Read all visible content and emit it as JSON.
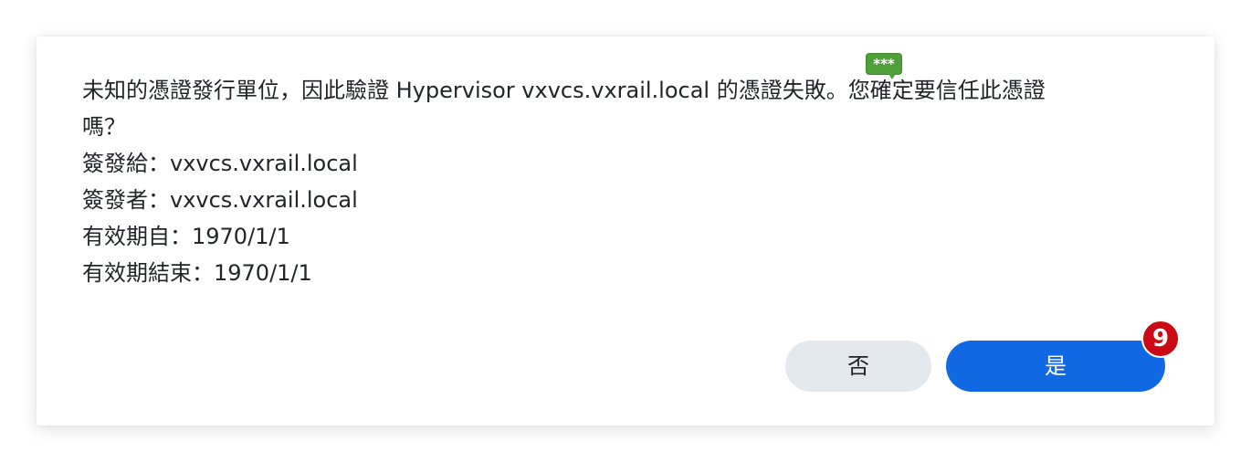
{
  "dialog": {
    "message_lines": [
      "未知的憑證發行單位，因此驗證 Hypervisor vxvcs.vxrail.local 的憑證失敗。您確定要信任此憑證",
      "嗎？",
      "簽發給：vxvcs.vxrail.local",
      "簽發者：vxvcs.vxrail.local",
      "有效期自：1970/1/1",
      "有效期結束：1970/1/1"
    ],
    "annotation_badge": "***",
    "no_label": "否",
    "yes_label": "是",
    "yes_badge_count": "9"
  },
  "colors": {
    "primary_button": "#1068e3",
    "secondary_button": "#e3e8ef",
    "annotation_badge": "#4fa03a",
    "count_badge": "#cc0a16"
  }
}
